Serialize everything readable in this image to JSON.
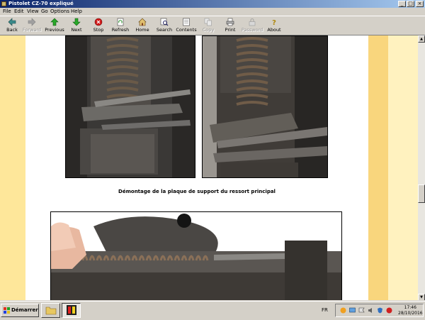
{
  "window": {
    "title": "Pistolet CZ-70 expliqué"
  },
  "menu": [
    "File",
    "Edit",
    "View",
    "Go",
    "Options",
    "Help"
  ],
  "toolbar": [
    {
      "label": "Back",
      "icon": "back-icon",
      "enabled": true
    },
    {
      "label": "Forward",
      "icon": "forward-icon",
      "enabled": false
    },
    {
      "label": "Previous",
      "icon": "previous-icon",
      "enabled": true
    },
    {
      "label": "Next",
      "icon": "next-icon",
      "enabled": true
    },
    {
      "label": "Stop",
      "icon": "stop-icon",
      "enabled": true
    },
    {
      "label": "Refresh",
      "icon": "refresh-icon",
      "enabled": true
    },
    {
      "label": "Home",
      "icon": "home-icon",
      "enabled": true
    },
    {
      "label": "Search",
      "icon": "search-icon",
      "enabled": true
    },
    {
      "label": "Contents",
      "icon": "contents-icon",
      "enabled": true
    },
    {
      "label": "Copy",
      "icon": "copy-icon",
      "enabled": false
    },
    {
      "label": "Print",
      "icon": "print-icon",
      "enabled": true
    },
    {
      "label": "Password",
      "icon": "password-icon",
      "enabled": false
    },
    {
      "label": "About",
      "icon": "about-icon",
      "enabled": true
    }
  ],
  "content": {
    "caption": "Démontage de la plaque de support du ressort principal"
  },
  "taskbar": {
    "start_label": "Démarrer",
    "language": "FR",
    "time": "17:46",
    "date": "28/10/2016"
  },
  "colors": {
    "titlebar_start": "#0a246a",
    "titlebar_end": "#a6caf0",
    "page_stripe_left": "#fee79a",
    "page_stripe_right": "#f9d67d",
    "page_stripe_far_right": "#fff2bf"
  }
}
